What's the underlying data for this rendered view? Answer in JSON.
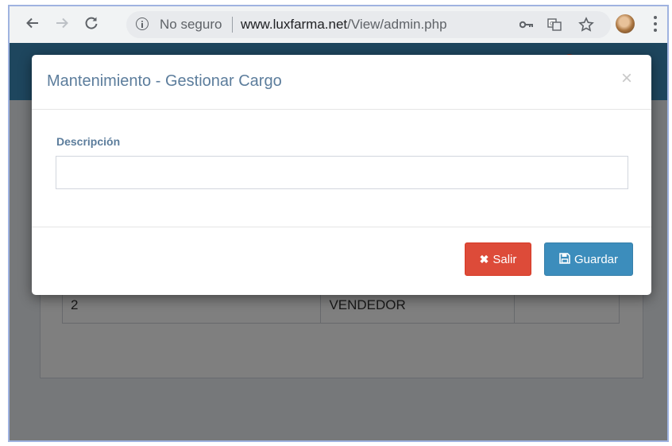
{
  "browser": {
    "security_text": "No seguro",
    "url_host": "www.luxfarma.net",
    "url_path": "/View/admin.php"
  },
  "modal": {
    "title": "Mantenimiento - Gestionar Cargo",
    "close_symbol": "×",
    "field_label": "Descripción",
    "field_value": "",
    "exit_label": "Salir",
    "save_label": "Guardar"
  },
  "background_table": {
    "rows": [
      {
        "id": "",
        "name": "",
        "extra": ""
      },
      {
        "id": "2",
        "name": "VENDEDOR",
        "extra": ""
      }
    ]
  },
  "icons": [
    "back-icon",
    "forward-icon",
    "reload-icon",
    "info-icon",
    "key-icon",
    "translate-icon",
    "star-icon",
    "avatar",
    "menu-icon",
    "close-icon",
    "times-icon",
    "save-icon"
  ],
  "colors": {
    "header": "#3c8dbc",
    "danger": "#dd4b39",
    "primary": "#3c8dbc",
    "title": "#5c7d9c"
  }
}
